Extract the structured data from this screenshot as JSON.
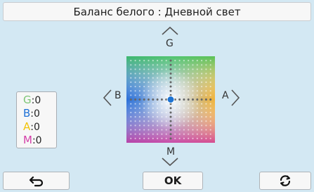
{
  "header": {
    "title": "Баланс белого : Дневной свет"
  },
  "directions": {
    "up": "G",
    "down": "M",
    "left": "B",
    "right": "A"
  },
  "wb_values": [
    {
      "key": "G",
      "sep": ":",
      "value": "0",
      "color": "#7cc576"
    },
    {
      "key": "B",
      "sep": ":",
      "value": "0",
      "color": "#1d6fd6"
    },
    {
      "key": "A",
      "sep": ":",
      "value": "0",
      "color": "#f2c40a"
    },
    {
      "key": "M",
      "sep": ":",
      "value": "0",
      "color": "#d33ea8"
    }
  ],
  "grid": {
    "selected_g_m": 0,
    "selected_b_a": 0,
    "cursor_color": "#1d73d2"
  },
  "buttons": {
    "back_icon": "return-arrow-icon",
    "ok_label": "OK",
    "reset_icon": "refresh-icon"
  }
}
